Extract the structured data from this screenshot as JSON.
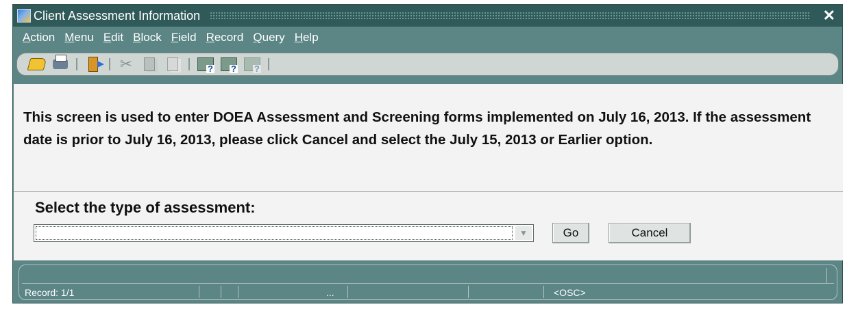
{
  "window": {
    "title": "Client Assessment Information",
    "close_glyph": "✕"
  },
  "menu": [
    {
      "u": "A",
      "rest": "ction"
    },
    {
      "u": "M",
      "rest": "enu"
    },
    {
      "u": "E",
      "rest": "dit"
    },
    {
      "u": "B",
      "rest": "lock"
    },
    {
      "u": "F",
      "rest": "ield"
    },
    {
      "u": "R",
      "rest": "ecord"
    },
    {
      "u": "Q",
      "rest": "uery"
    },
    {
      "u": "H",
      "rest": "elp"
    }
  ],
  "toolbar": {
    "icons": [
      "save-icon",
      "print-icon",
      "exit-icon",
      "cut-icon",
      "copy-icon",
      "paste-icon",
      "enter-query-icon",
      "execute-query-icon",
      "cancel-query-icon"
    ],
    "cut_glyph": "✂"
  },
  "message": "This screen is used to enter DOEA Assessment and Screening forms implemented on July 16, 2013. If the assessment date is prior to July 16, 2013, please click Cancel and select the July 15, 2013 or Earlier option.",
  "form": {
    "select_label": "Select the type of assessment:",
    "select_value": "",
    "select_arrow": "▼",
    "go_label": "Go",
    "cancel_label": "Cancel"
  },
  "status": {
    "record": "Record: 1/1",
    "ellipsis": "...",
    "osc": "<OSC>"
  },
  "colors": {
    "window_bg": "#5c8585",
    "titlebar_bg": "#305a5a",
    "content_bg": "#f3f3f3",
    "toolbar_bg": "#cfd6d3"
  }
}
